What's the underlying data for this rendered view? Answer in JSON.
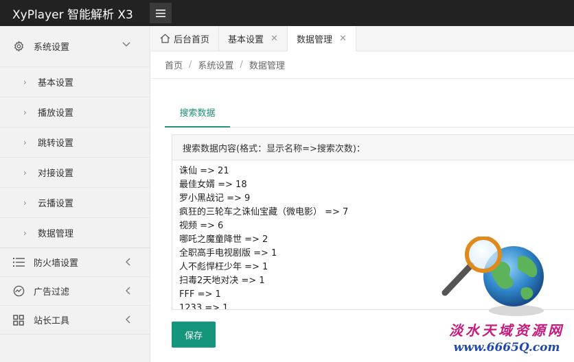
{
  "header": {
    "title": "XyPlayer 智能解析 X3"
  },
  "sidebar": {
    "system_settings": {
      "label": "系统设置",
      "items": [
        {
          "label": "基本设置"
        },
        {
          "label": "播放设置"
        },
        {
          "label": "跳转设置"
        },
        {
          "label": "对接设置"
        },
        {
          "label": "云播设置"
        },
        {
          "label": "数据管理"
        }
      ]
    },
    "firewall": {
      "label": "防火墙设置"
    },
    "ad_filter": {
      "label": "广告过滤"
    },
    "webmaster_tools": {
      "label": "站长工具"
    }
  },
  "tabs": [
    {
      "label": "后台首页"
    },
    {
      "label": "基本设置"
    },
    {
      "label": "数据管理"
    }
  ],
  "breadcrumb": {
    "home": "首页",
    "section": "系统设置",
    "page": "数据管理",
    "separator": "/"
  },
  "subtab": {
    "label": "搜索数据"
  },
  "panel": {
    "heading": "搜索数据内容(格式：显示名称=>搜索次数)：",
    "lines": [
      "诛仙 => 21",
      "最佳女婿 => 18",
      "罗小黑战记 => 9",
      "疯狂的三轮车之诛仙宝藏（微电影） => 7",
      "视频 => 6",
      "哪吒之魔童降世 => 2",
      "全职高手电视剧版 => 1",
      "人不彪悍枉少年 => 1",
      "扫毒2天地对决 => 1",
      "FFF => 1",
      "1233 => 1"
    ]
  },
  "actions": {
    "save_label": "保存"
  },
  "watermark": {
    "line1": "淡水天域资源网",
    "line2": "www.6665Q.com"
  },
  "colors": {
    "accent": "#15957c",
    "topbar": "#222222",
    "sidebar_bg": "#f2f2f2"
  }
}
